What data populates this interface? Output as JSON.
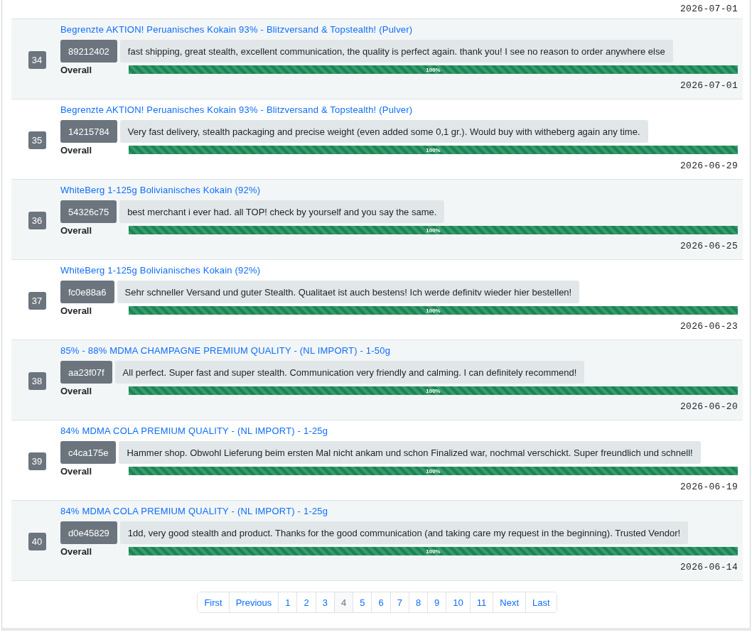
{
  "previous_date": "2026-07-01",
  "reviews": [
    {
      "number": "34",
      "product": "Begrenzte AKTION! Peruanisches Kokain 93% - Blitzversand & Topstealth! (Pulver)",
      "buyer": "89212402",
      "comment": "fast shipping, great stealth, excellent communication, the quality is perfect again. thank you! I see no reason to order anywhere else",
      "rating_label": "Overall",
      "level": 1,
      "reading": "100%",
      "date": "2026-07-01"
    },
    {
      "number": "35",
      "product": "Begrenzte AKTION! Peruanisches Kokain 93% - Blitzversand & Topstealth! (Pulver)",
      "buyer": "14215784",
      "comment": "Very fast delivery, stealth packaging and precise weight (even added some 0,1 gr.). Would buy with witheberg again any time.",
      "rating_label": "Overall",
      "level": 1,
      "reading": "100%",
      "date": "2026-06-29"
    },
    {
      "number": "36",
      "product": "WhiteBerg 1-125g Bolivianisches Kokain (92%)",
      "buyer": "54326c75",
      "comment": "best merchant i ever had. all TOP! check by yourself and you say the same.",
      "rating_label": "Overall",
      "level": 1,
      "reading": "100%",
      "date": "2026-06-25"
    },
    {
      "number": "37",
      "product": "WhiteBerg 1-125g Bolivianisches Kokain (92%)",
      "buyer": "fc0e88a6",
      "comment": "Sehr schneller Versand und guter Stealth. Qualitaet ist auch bestens! Ich werde definitv wieder hier bestellen!",
      "rating_label": "Overall",
      "level": 1,
      "reading": "100%",
      "date": "2026-06-23"
    },
    {
      "number": "38",
      "product": "85% - 88% MDMA CHAMPAGNE PREMIUM QUALITY - (NL IMPORT) - 1-50g",
      "buyer": "aa23f07f",
      "comment": "All perfect. Super fast and super stealth. Communication very friendly and calming. I can definitely recommend!",
      "rating_label": "Overall",
      "level": 1,
      "reading": "100%",
      "date": "2026-06-20"
    },
    {
      "number": "39",
      "product": "84% MDMA COLA PREMIUM QUALITY - (NL IMPORT) - 1-25g",
      "buyer": "c4ca175e",
      "comment": "Hammer shop. Obwohl Lieferung beim ersten Mal nicht ankam und schon Finalized war, nochmal verschickt. Super freundlich und schnell!",
      "rating_label": "Overall",
      "level": 1,
      "reading": "100%",
      "date": "2026-06-19"
    },
    {
      "number": "40",
      "product": "84% MDMA COLA PREMIUM QUALITY - (NL IMPORT) - 1-25g",
      "buyer": "d0e45829",
      "comment": "1dd, very good stealth and product. Thanks for the good communication (and taking care my request in the beginning). Trusted Vendor!",
      "rating_label": "Overall",
      "level": 1,
      "reading": "100%",
      "date": "2026-06-14"
    }
  ],
  "pagination": [
    {
      "label": "First",
      "selected": false
    },
    {
      "label": "Previous",
      "selected": false
    },
    {
      "label": "1",
      "selected": false
    },
    {
      "label": "2",
      "selected": false
    },
    {
      "label": "3",
      "selected": false
    },
    {
      "label": "4",
      "selected": true
    },
    {
      "label": "5",
      "selected": false
    },
    {
      "label": "6",
      "selected": false
    },
    {
      "label": "7",
      "selected": false
    },
    {
      "label": "8",
      "selected": false
    },
    {
      "label": "9",
      "selected": false
    },
    {
      "label": "10",
      "selected": false
    },
    {
      "label": "11",
      "selected": false
    },
    {
      "label": "Next",
      "selected": false
    },
    {
      "label": "Last",
      "selected": false
    }
  ]
}
